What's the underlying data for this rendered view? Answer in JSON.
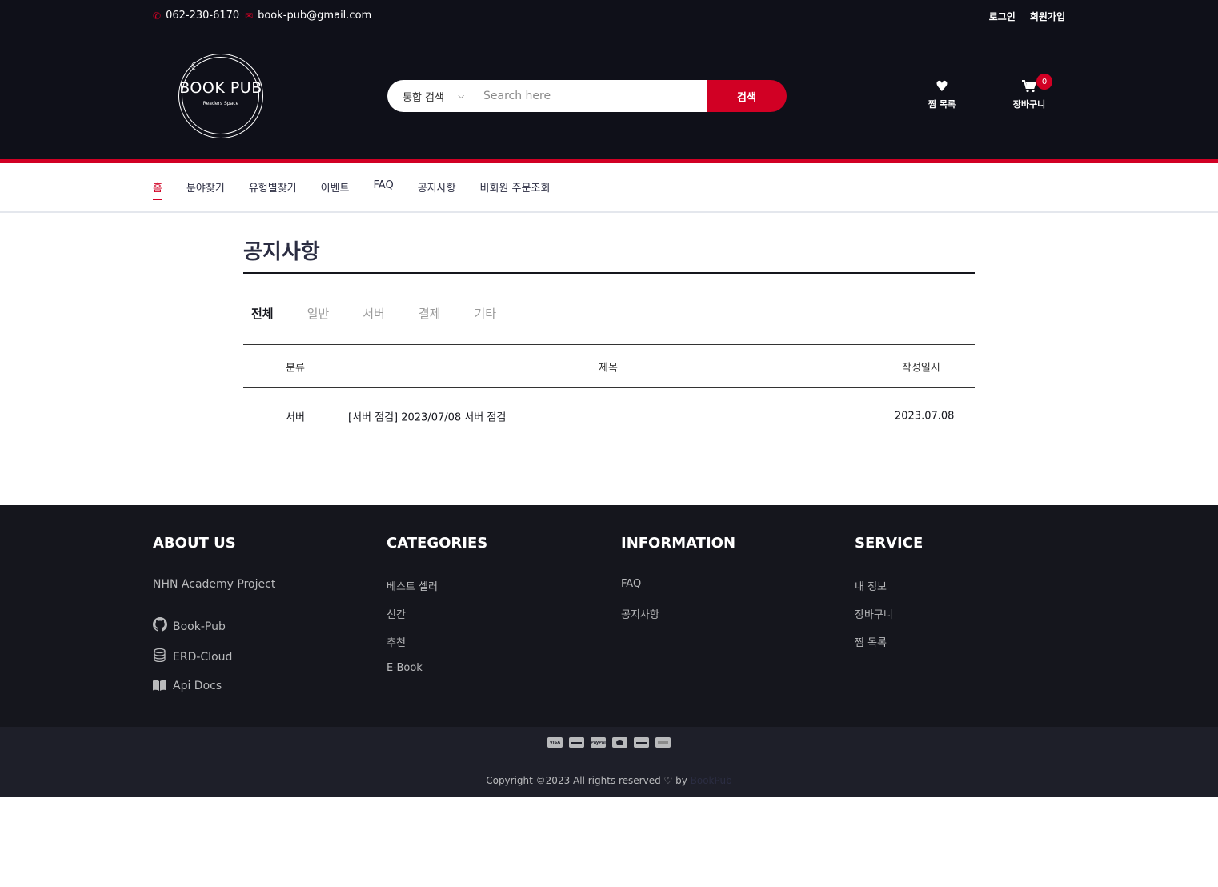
{
  "top_header": {
    "phone": "062-230-6170",
    "email": "book-pub@gmail.com",
    "login": "로그인",
    "signup": "회원가입"
  },
  "logo": {
    "title": "BOOK PUB",
    "subtitle": "Readers Space"
  },
  "search": {
    "category": "통합 검색",
    "placeholder": "Search here",
    "button": "검색"
  },
  "header_actions": {
    "wishlist": "찜 목록",
    "cart": "장바구니",
    "cart_count": "0"
  },
  "nav": [
    "홈",
    "분야찾기",
    "유형별찾기",
    "이벤트",
    "FAQ",
    "공지사항",
    "비회원 주문조회"
  ],
  "page": {
    "title": "공지사항",
    "tabs": [
      "전체",
      "일반",
      "서버",
      "결제",
      "기타"
    ],
    "table": {
      "headers": [
        "분류",
        "제목",
        "작성일시"
      ],
      "rows": [
        [
          "서버",
          "[서버 점검] 2023/07/08 서버 점검",
          "2023.07.08"
        ]
      ]
    }
  },
  "footer": {
    "about": {
      "title": "ABOUT US",
      "text": "NHN Academy Project",
      "links": [
        "Book-Pub",
        "ERD-Cloud",
        "Api Docs"
      ]
    },
    "categories": {
      "title": "CATEGORIES",
      "links": [
        "베스트 셀러",
        "신간",
        "추천",
        "E-Book"
      ]
    },
    "information": {
      "title": "INFORMATION",
      "links": [
        "FAQ",
        "공지사항"
      ]
    },
    "service": {
      "title": "SERVICE",
      "links": [
        "내 정보",
        "장바구니",
        "찜 목록"
      ]
    },
    "payment_icons": [
      "VISA",
      "card",
      "PayPal",
      "MC",
      "disc",
      "AMEX"
    ],
    "copyright": "Copyright ©2023 All rights reserved ♡ by",
    "copyright_brand": "BookPub"
  },
  "colors": {
    "accent": "#d10024",
    "dark": "#0f1019",
    "footer": "#15161d",
    "bottom_footer": "#1e1f29"
  }
}
